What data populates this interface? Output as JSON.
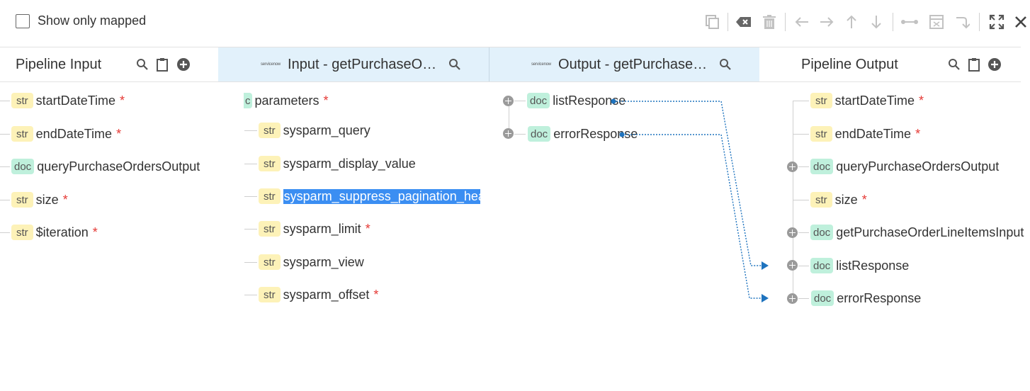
{
  "top_bar": {
    "show_only_mapped_label": "Show only mapped",
    "toolbar_icons": [
      "copy-icon",
      "clear-icon",
      "delete-icon",
      "arrow-left-icon",
      "arrow-right-icon",
      "arrow-up-icon",
      "arrow-down-icon",
      "link-icon",
      "transform-icon",
      "loop-icon",
      "expand-icon",
      "close-icon"
    ]
  },
  "columns": {
    "pipeline_input": {
      "title": "Pipeline Input"
    },
    "service_input": {
      "logo": "servicenow",
      "title": "Input - getPurchaseOrders"
    },
    "service_output": {
      "logo": "servicenow",
      "title": "Output - getPurchaseOrders"
    },
    "pipeline_output": {
      "title": "Pipeline Output"
    }
  },
  "pipeline_input_fields": [
    {
      "type": "str",
      "name": "startDateTime",
      "required": "*"
    },
    {
      "type": "str",
      "name": "endDateTime",
      "required": "*"
    },
    {
      "type": "doc",
      "name": "queryPurchaseOrdersOutput",
      "required": ""
    },
    {
      "type": "str",
      "name": "size",
      "required": "*"
    },
    {
      "type": "str",
      "name": "$iteration",
      "required": "*"
    }
  ],
  "service_input_fields": {
    "root": {
      "type": "c",
      "name": "parameters",
      "required": "*"
    },
    "children": [
      {
        "type": "str",
        "name": "sysparm_query",
        "required": ""
      },
      {
        "type": "str",
        "name": "sysparm_display_value",
        "required": ""
      },
      {
        "type": "str",
        "name": "sysparm_suppress_pagination_header",
        "required": "",
        "selected": true
      },
      {
        "type": "str",
        "name": "sysparm_limit",
        "required": "*"
      },
      {
        "type": "str",
        "name": "sysparm_view",
        "required": ""
      },
      {
        "type": "str",
        "name": "sysparm_offset",
        "required": "*"
      }
    ]
  },
  "service_output_fields": [
    {
      "type": "doc",
      "name": "listResponse",
      "required": ""
    },
    {
      "type": "doc",
      "name": "errorResponse",
      "required": ""
    }
  ],
  "pipeline_output_fields": [
    {
      "type": "str",
      "name": "startDateTime",
      "required": "*"
    },
    {
      "type": "str",
      "name": "endDateTime",
      "required": "*"
    },
    {
      "type": "doc",
      "name": "queryPurchaseOrdersOutput",
      "required": ""
    },
    {
      "type": "str",
      "name": "size",
      "required": "*"
    },
    {
      "type": "doc",
      "name": "getPurchaseOrderLineItemsInput",
      "required": ""
    },
    {
      "type": "doc",
      "name": "listResponse",
      "required": ""
    },
    {
      "type": "doc",
      "name": "errorResponse",
      "required": ""
    }
  ],
  "mappings": [
    {
      "from": "listResponse",
      "to": "listResponse"
    },
    {
      "from": "errorResponse",
      "to": "errorResponse"
    }
  ],
  "colors": {
    "accent": "#1e73be",
    "header_highlight": "#e2f1fb",
    "str_badge": "#fdf2b8",
    "doc_badge": "#bff0dc",
    "required": "#e53935",
    "selection": "#3b8ef2"
  }
}
